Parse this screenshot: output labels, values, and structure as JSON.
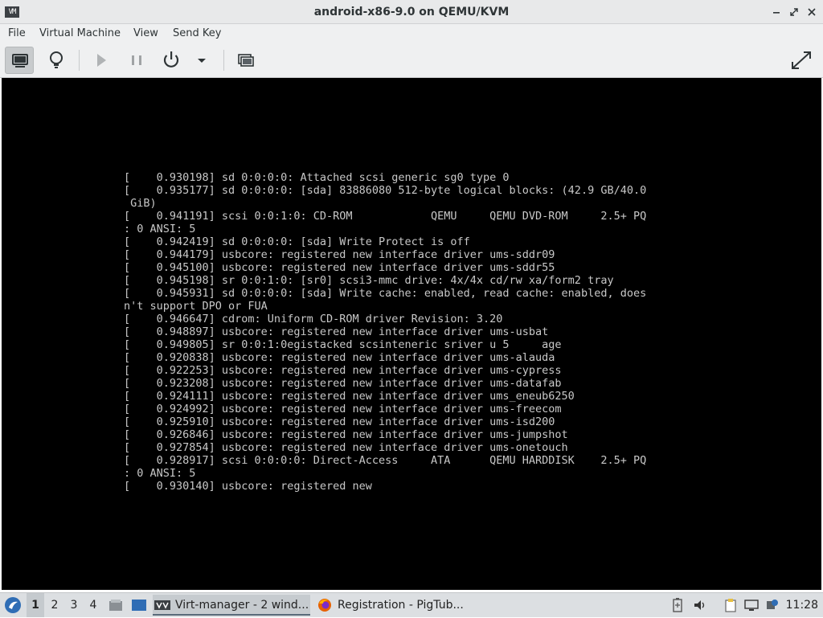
{
  "window": {
    "title": "android-x86-9.0 on QEMU/KVM",
    "app_icon_text": "VM",
    "controls": {
      "minimize": "▁",
      "restore": "▫",
      "close": "✕"
    }
  },
  "menubar": {
    "items": [
      "File",
      "Virtual Machine",
      "View",
      "Send Key"
    ]
  },
  "toolbar": {
    "buttons": [
      "console-monitor-icon",
      "lightbulb-icon",
      "play-icon",
      "pause-icon",
      "power-icon",
      "dropdown-arrow-icon",
      "snapshots-icon",
      "fullscreen-icon"
    ]
  },
  "console": {
    "lines": [
      "[    0.930198] sd 0:0:0:0: Attached scsi generic sg0 type 0",
      "[    0.935177] sd 0:0:0:0: [sda] 83886080 512-byte logical blocks: (42.9 GB/40.0",
      " GiB)",
      "[    0.941191] scsi 0:0:1:0: CD-ROM            QEMU     QEMU DVD-ROM     2.5+ PQ",
      ": 0 ANSI: 5",
      "[    0.942419] sd 0:0:0:0: [sda] Write Protect is off",
      "[    0.944179] usbcore: registered new interface driver ums-sddr09",
      "[    0.945100] usbcore: registered new interface driver ums-sddr55",
      "[    0.945198] sr 0:0:1:0: [sr0] scsi3-mmc drive: 4x/4x cd/rw xa/form2 tray",
      "[    0.945931] sd 0:0:0:0: [sda] Write cache: enabled, read cache: enabled, does",
      "n't support DPO or FUA",
      "[    0.946647] cdrom: Uniform CD-ROM driver Revision: 3.20",
      "[    0.948897] usbcore: registered new interface driver ums-usbat",
      "[    0.949805] sr 0:0:1:0egistacked scsinteneric sriver u 5     age",
      "[    0.920838] usbcore: registered new interface driver ums-alauda",
      "[    0.922253] usbcore: registered new interface driver ums-cypress",
      "[    0.923208] usbcore: registered new interface driver ums-datafab",
      "[    0.924111] usbcore: registered new interface driver ums_eneub6250",
      "[    0.924992] usbcore: registered new interface driver ums-freecom",
      "[    0.925910] usbcore: registered new interface driver ums-isd200",
      "[    0.926846] usbcore: registered new interface driver ums-jumpshot",
      "[    0.927854] usbcore: registered new interface driver ums-onetouch",
      "[    0.928917] scsi 0:0:0:0: Direct-Access     ATA      QEMU HARDDISK    2.5+ PQ",
      ": 0 ANSI: 5",
      "[    0.930140] usbcore: registered new"
    ]
  },
  "taskbar": {
    "start_icon": "start-menu-icon",
    "workspaces": [
      "1",
      "2",
      "3",
      "4"
    ],
    "active_workspace": "1",
    "tasks": [
      {
        "label": "Virt-manager - 2 wind...",
        "icon": "virt-manager-icon"
      },
      {
        "label": "Registration - PigTub...",
        "icon": "firefox-icon"
      }
    ],
    "tray_icons": [
      "battery-icon",
      "volume-icon",
      "clipboard-icon",
      "display-icon",
      "network-icon"
    ],
    "clock": "11:28"
  }
}
